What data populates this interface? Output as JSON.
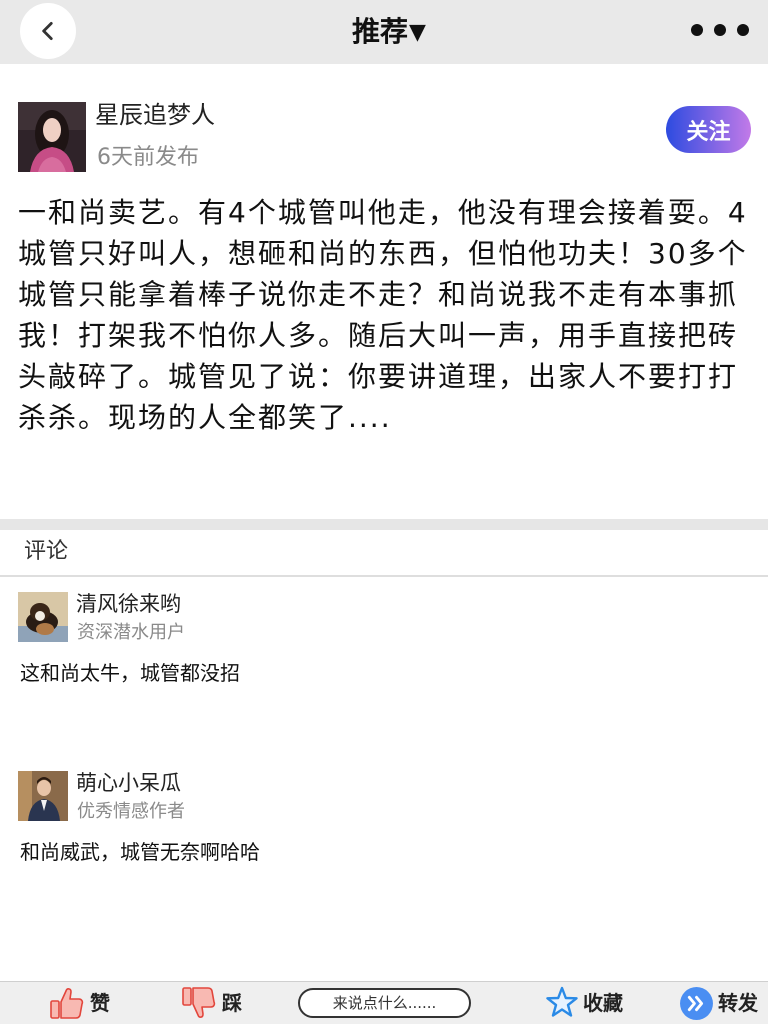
{
  "header": {
    "title": "推荐",
    "title_caret": "▼",
    "back_icon": "chevron-left-icon",
    "more_icon": "more-dots-icon"
  },
  "post": {
    "author": {
      "name": "星辰追梦人",
      "published": "6天前发布"
    },
    "follow_label": "关注",
    "content": "一和尚卖艺。有4个城管叫他走，他没有理会接着耍。4城管只好叫人，想砸和尚的东西，但怕他功夫！30多个城管只能拿着棒子说你走不走？和尚说我不走有本事抓我！打架我不怕你人多。随后大叫一声，用手直接把砖头敲碎了。城管见了说：你要讲道理，出家人不要打打杀杀。现场的人全都笑了...."
  },
  "comments_section": {
    "title": "评论"
  },
  "comments": [
    {
      "name": "清风徐来哟",
      "badge": "资深潜水用户",
      "text": "这和尚太牛，城管都没招"
    },
    {
      "name": "萌心小呆瓜",
      "badge": "优秀情感作者",
      "text": "和尚威武，城管无奈啊哈哈"
    }
  ],
  "bottom_bar": {
    "like": {
      "label": "赞",
      "icon": "thumbs-up-icon"
    },
    "dislike": {
      "label": "踩",
      "icon": "thumbs-down-icon"
    },
    "comment_input": {
      "placeholder": "来说点什么......",
      "value": ""
    },
    "favorite": {
      "label": "收藏",
      "icon": "star-icon"
    },
    "share": {
      "label": "转发",
      "icon": "forward-icon"
    }
  },
  "colors": {
    "header_bg": "#e9e9e9",
    "follow_gradient_start": "#2d4be0",
    "follow_gradient_end": "#c27ae8",
    "like_icon": "#e2463c",
    "favorite_icon": "#2a8ae6",
    "share_icon": "#4a8ef2"
  }
}
